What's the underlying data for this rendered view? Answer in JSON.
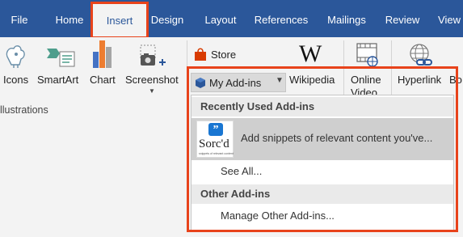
{
  "tabs": [
    {
      "label": "File"
    },
    {
      "label": "Home"
    },
    {
      "label": "Insert"
    },
    {
      "label": "Design"
    },
    {
      "label": "Layout"
    },
    {
      "label": "References"
    },
    {
      "label": "Mailings"
    },
    {
      "label": "Review"
    },
    {
      "label": "View"
    }
  ],
  "active_tab": "Insert",
  "ribbon": {
    "icons_label": "Icons",
    "smartart_label": "SmartArt",
    "chart_label": "Chart",
    "screenshot_label": "Screenshot",
    "illustrations_group": "llustrations",
    "store_label": "Store",
    "myaddins_label": "My Add-ins",
    "wikipedia_label": "Wikipedia",
    "online_video_label": "Online Video",
    "hyperlink_label": "Hyperlink",
    "bookmark_label": "Bo"
  },
  "addins_menu": {
    "recent_header": "Recently Used Add-ins",
    "recent_item_text": "Add snippets of relevant content you've...",
    "recent_item_logo": "Sorc'd",
    "recent_item_logo_tagline": "snippets of relevant content",
    "see_all": "See All...",
    "other_header": "Other Add-ins",
    "manage": "Manage Other Add-ins..."
  },
  "colors": {
    "accent": "#2b579a",
    "highlight": "#e8431b",
    "store_red": "#d83b01"
  }
}
